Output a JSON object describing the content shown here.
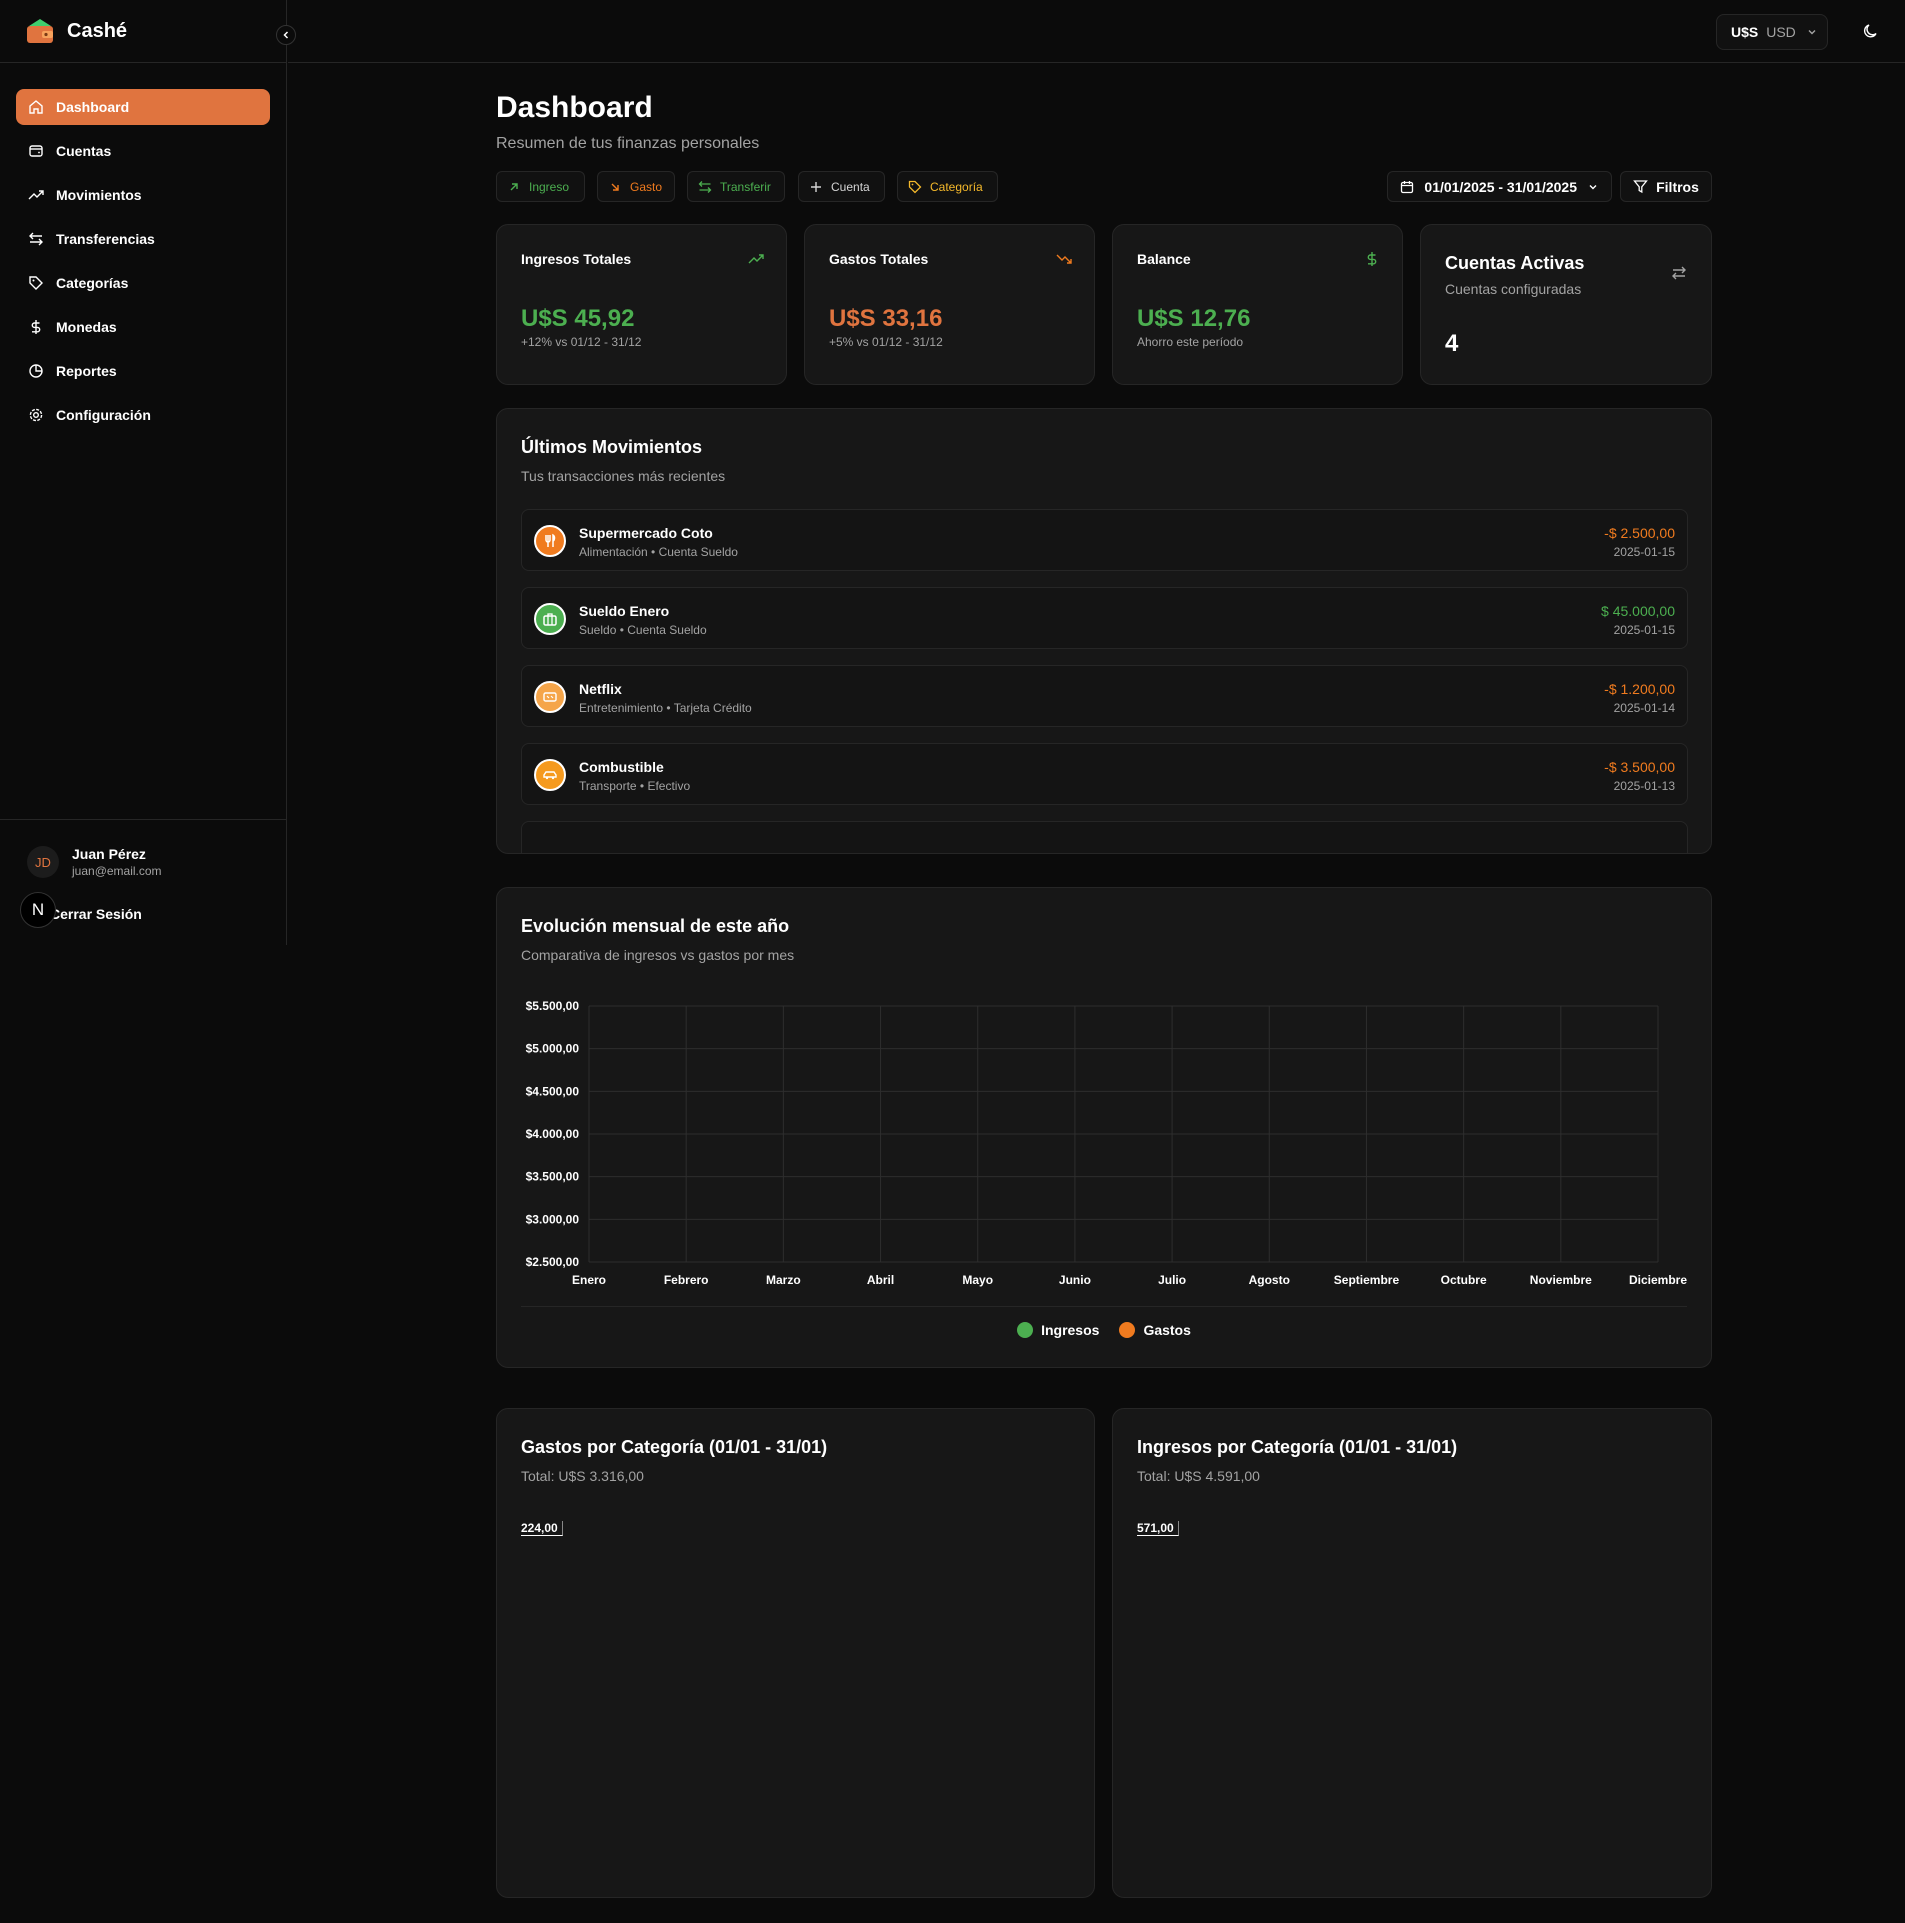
{
  "app": {
    "name": "Cashé"
  },
  "colors": {
    "accent": "#e0743f",
    "income": "#4caf50",
    "expense": "#f07b1f",
    "category": "#f5b92b"
  },
  "sidebar": {
    "items": [
      {
        "label": "Dashboard",
        "icon": "home-icon",
        "active": true
      },
      {
        "label": "Cuentas",
        "icon": "wallet-icon"
      },
      {
        "label": "Movimientos",
        "icon": "trending-up-icon"
      },
      {
        "label": "Transferencias",
        "icon": "arrows-left-right-icon"
      },
      {
        "label": "Categorías",
        "icon": "tag-icon"
      },
      {
        "label": "Monedas",
        "icon": "dollar-icon"
      },
      {
        "label": "Reportes",
        "icon": "pie-chart-icon"
      },
      {
        "label": "Configuración",
        "icon": "gear-icon"
      }
    ],
    "user": {
      "initials": "JD",
      "name": "Juan Pérez",
      "email": "juan@email.com"
    },
    "logout_label": "Cerrar Sesión",
    "badge": "N"
  },
  "topbar": {
    "currency_symbol": "U$S",
    "currency_code": "USD"
  },
  "header": {
    "title": "Dashboard",
    "subtitle": "Resumen de tus finanzas personales"
  },
  "actions": {
    "ingreso": "Ingreso",
    "gasto": "Gasto",
    "transferir": "Transferir",
    "cuenta": "Cuenta",
    "categoria": "Categoría",
    "date_range": "01/01/2025 - 31/01/2025",
    "filters": "Filtros"
  },
  "stats": {
    "income": {
      "title": "Ingresos Totales",
      "value": "U$S 45,92",
      "note": "+12% vs 01/12 - 31/12"
    },
    "expense": {
      "title": "Gastos Totales",
      "value": "U$S 33,16",
      "note": "+5% vs 01/12 - 31/12"
    },
    "balance": {
      "title": "Balance",
      "value": "U$S 12,76",
      "note": "Ahorro este período"
    },
    "accounts": {
      "title": "Cuentas Activas",
      "subtitle": "Cuentas configuradas",
      "value": "4"
    }
  },
  "movements": {
    "title": "Últimos Movimientos",
    "subtitle": "Tus transacciones más recientes",
    "items": [
      {
        "name": "Supermercado Coto",
        "meta": "Alimentación • Cuenta Sueldo",
        "amount": "-$ 2.500,00",
        "date": "2025-01-15",
        "type": "expense",
        "icon": "utensils-icon"
      },
      {
        "name": "Sueldo Enero",
        "meta": "Sueldo • Cuenta Sueldo",
        "amount": "$ 45.000,00",
        "date": "2025-01-15",
        "type": "income",
        "icon": "briefcase-icon"
      },
      {
        "name": "Netflix",
        "meta": "Entretenimiento • Tarjeta Crédito",
        "amount": "-$ 1.200,00",
        "date": "2025-01-14",
        "type": "expense",
        "icon": "ticket-icon"
      },
      {
        "name": "Combustible",
        "meta": "Transporte • Efectivo",
        "amount": "-$ 3.500,00",
        "date": "2025-01-13",
        "type": "expense",
        "icon": "car-icon"
      }
    ]
  },
  "evolution": {
    "title": "Evolución mensual de este año",
    "subtitle": "Comparativa de ingresos vs gastos por mes",
    "legend": [
      "Ingresos",
      "Gastos"
    ]
  },
  "chart_data": {
    "type": "line",
    "categories": [
      "Enero",
      "Febrero",
      "Marzo",
      "Abril",
      "Mayo",
      "Junio",
      "Julio",
      "Agosto",
      "Septiembre",
      "Octubre",
      "Noviembre",
      "Diciembre"
    ],
    "yticks": [
      "$2.500,00",
      "$3.000,00",
      "$3.500,00",
      "$4.000,00",
      "$4.500,00",
      "$5.000,00",
      "$5.500,00"
    ],
    "ylim": [
      2500,
      5500
    ],
    "grid": true,
    "legend_position": "bottom",
    "series": [
      {
        "name": "Ingresos",
        "values": []
      },
      {
        "name": "Gastos",
        "values": []
      }
    ]
  },
  "expense_categories": {
    "title": "Gastos por Categoría (01/01 - 31/01)",
    "total": "Total: U$S 3.316,00",
    "label": "224,00"
  },
  "income_categories": {
    "title": "Ingresos por Categoría (01/01 - 31/01)",
    "total": "Total: U$S 4.591,00",
    "label": "571,00"
  }
}
